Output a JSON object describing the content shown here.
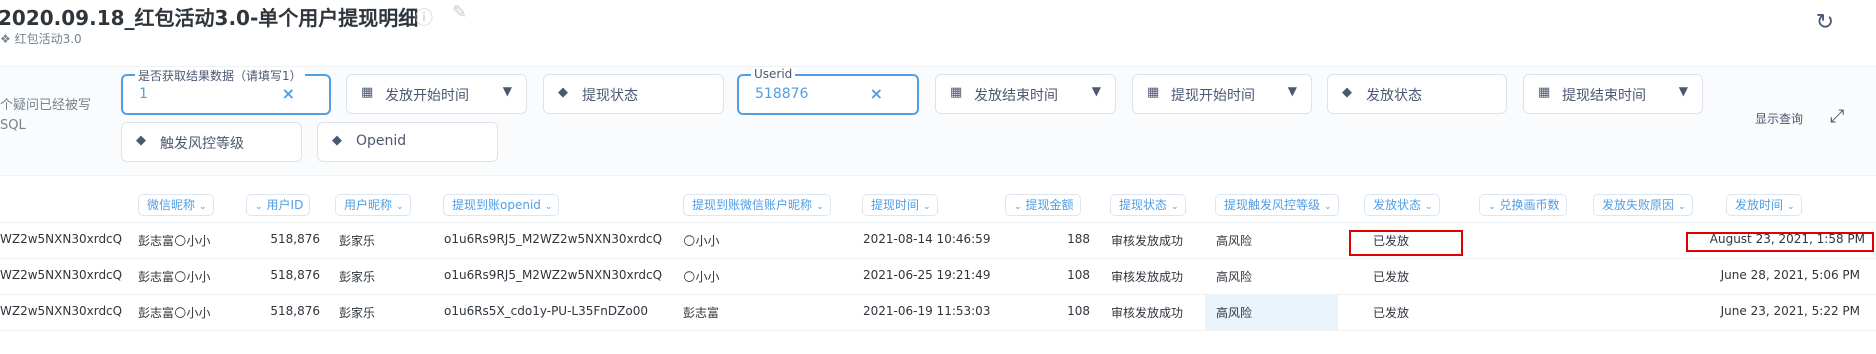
{
  "header": {
    "title": "2020.09.18_红包活动3.0-单个用户提现明细",
    "collection": "红包活动3.0"
  },
  "sidebar_text": {
    "line1": "个疑问已经被写",
    "line2": "SQL"
  },
  "filters": [
    {
      "label": "是否获取结果数据（请填写1）",
      "value": "1",
      "active": true
    },
    {
      "placeholder": "发放开始时间",
      "type": "date"
    },
    {
      "placeholder": "提现状态",
      "type": "tag"
    },
    {
      "label": "Userid",
      "value": "518876",
      "active": true
    },
    {
      "placeholder": "发放结束时间",
      "type": "date"
    },
    {
      "placeholder": "提现开始时间",
      "type": "date"
    },
    {
      "placeholder": "发放状态",
      "type": "tag"
    },
    {
      "placeholder": "提现结束时间",
      "type": "date"
    },
    {
      "placeholder": "触发风控等级",
      "type": "tag"
    },
    {
      "placeholder": "Openid",
      "type": "tag"
    }
  ],
  "show_query_label": "显示查询",
  "table": {
    "columns": [
      "微信昵称",
      "用户ID",
      "用户昵称",
      "提现到账openid",
      "提现到账微信账户昵称",
      "提现时间",
      "提现金额",
      "提现状态",
      "提现触发风控等级",
      "发放状态",
      "兑换画币数",
      "发放失败原因",
      "发放时间"
    ],
    "rows": [
      [
        "WZ2w5NXN30xrdcQ",
        "彭志富🌕小小",
        "518,876",
        "彭家乐",
        "o1u6Rs9RJ5_M2WZ2w5NXN30xrdcQ",
        "🌕小小",
        "2021-08-14 10:46:59",
        "188",
        "审核发放成功",
        "高风险",
        "已发放",
        "",
        "",
        "August 23, 2021, 1:58 PM"
      ],
      [
        "WZ2w5NXN30xrdcQ",
        "彭志富🌕小小",
        "518,876",
        "彭家乐",
        "o1u6Rs9RJ5_M2WZ2w5NXN30xrdcQ",
        "🌕小小",
        "2021-06-25 19:21:49",
        "108",
        "审核发放成功",
        "高风险",
        "已发放",
        "",
        "",
        "June 28, 2021, 5:06 PM"
      ],
      [
        "WZ2w5NXN30xrdcQ",
        "彭志富🌕小小",
        "518,876",
        "彭家乐",
        "o1u6Rs5X_cdo1y-PU-L35FnDZo00",
        "彭志富",
        "2021-06-19 11:53:03",
        "108",
        "审核发放成功",
        "高风险",
        "已发放",
        "",
        "",
        "June 23, 2021, 5:22 PM"
      ]
    ]
  },
  "colors": {
    "accent": "#509ee3",
    "highlight_box": "#e00000",
    "selected_cell": "#eaf3fc"
  }
}
